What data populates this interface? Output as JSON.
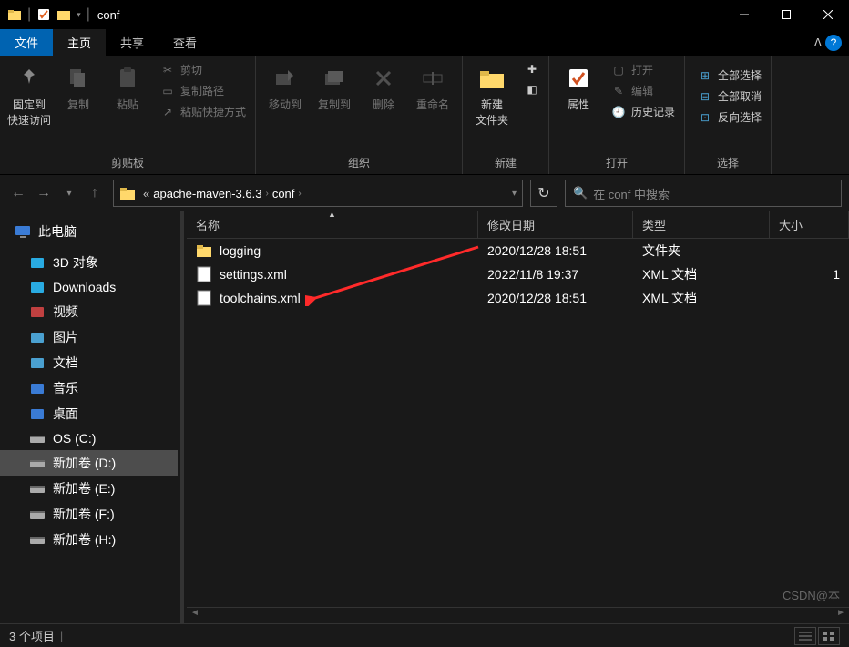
{
  "titlebar": {
    "title": "conf"
  },
  "tabs": {
    "file": "文件",
    "home": "主页",
    "share": "共享",
    "view": "查看"
  },
  "ribbon": {
    "pin": "固定到\n快速访问",
    "copy": "复制",
    "paste": "粘贴",
    "cut": "剪切",
    "copypath": "复制路径",
    "pasteshort": "粘贴快捷方式",
    "clipboard_group": "剪贴板",
    "moveto": "移动到",
    "copyto": "复制到",
    "delete": "删除",
    "rename": "重命名",
    "organize_group": "组织",
    "newfolder": "新建\n文件夹",
    "new_group": "新建",
    "properties": "属性",
    "open": "打开",
    "edit": "编辑",
    "history": "历史记录",
    "open_group": "打开",
    "selectall": "全部选择",
    "selectnone": "全部取消",
    "invertsel": "反向选择",
    "select_group": "选择"
  },
  "breadcrumb": {
    "part1": "apache-maven-3.6.3",
    "part2": "conf",
    "dropdown_hint": ""
  },
  "search": {
    "placeholder": "在 conf 中搜索"
  },
  "sidebar": {
    "root": "此电脑",
    "items": [
      {
        "label": "3D 对象",
        "color": "#29abe2"
      },
      {
        "label": "Downloads",
        "color": "#29abe2"
      },
      {
        "label": "视频",
        "color": "#c04040"
      },
      {
        "label": "图片",
        "color": "#4aa0d0"
      },
      {
        "label": "文档",
        "color": "#4aa0d0"
      },
      {
        "label": "音乐",
        "color": "#3a7bd5"
      },
      {
        "label": "桌面",
        "color": "#3a7bd5"
      },
      {
        "label": "OS (C:)",
        "color": "#888"
      },
      {
        "label": "新加卷 (D:)",
        "color": "#888",
        "selected": true
      },
      {
        "label": "新加卷 (E:)",
        "color": "#888"
      },
      {
        "label": "新加卷 (F:)",
        "color": "#888"
      },
      {
        "label": "新加卷 (H:)",
        "color": "#888"
      }
    ]
  },
  "columns": {
    "name": "名称",
    "date": "修改日期",
    "type": "类型",
    "size": "大小"
  },
  "files": [
    {
      "icon": "folder",
      "name": "logging",
      "date": "2020/12/28 18:51",
      "type": "文件夹",
      "size": ""
    },
    {
      "icon": "xml",
      "name": "settings.xml",
      "date": "2022/11/8 19:37",
      "type": "XML 文档",
      "size": "1"
    },
    {
      "icon": "xml",
      "name": "toolchains.xml",
      "date": "2020/12/28 18:51",
      "type": "XML 文档",
      "size": ""
    }
  ],
  "status": {
    "text": "3 个项目"
  },
  "watermark": "CSDN@本"
}
